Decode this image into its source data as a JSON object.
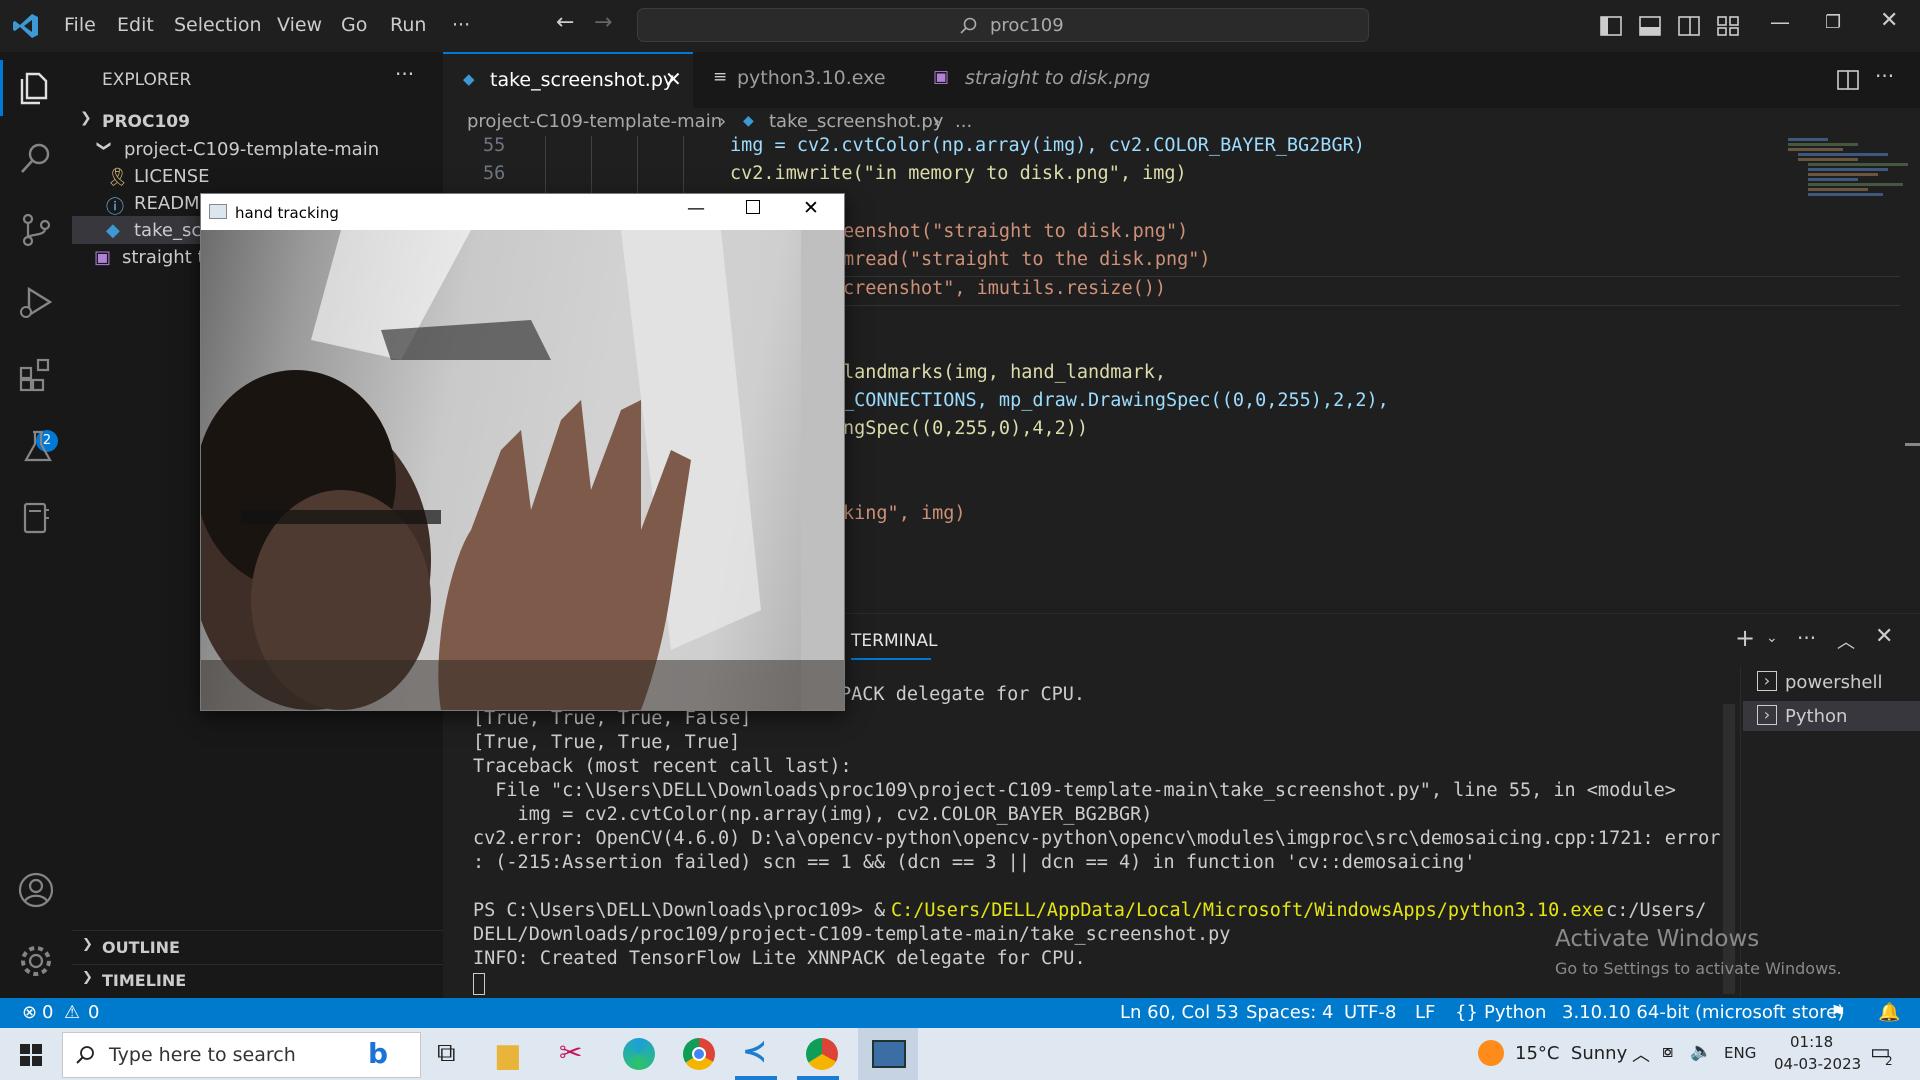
{
  "menu": [
    "File",
    "Edit",
    "Selection",
    "View",
    "Go",
    "Run",
    "···"
  ],
  "command_center": "proc109",
  "activity": {
    "extensions_badge": "2"
  },
  "sidebar": {
    "title": "EXPLORER",
    "root": "PROC109",
    "folder": "project-C109-template-main",
    "files": [
      "LICENSE",
      "READM",
      "take_scr"
    ],
    "root_file": "straight t",
    "outline": "OUTLINE",
    "timeline": "TIMELINE"
  },
  "tabs": [
    {
      "label": "take_screenshot.py"
    },
    {
      "label": "python3.10.exe"
    },
    {
      "label": "straight to disk.png"
    }
  ],
  "breadcrumb": {
    "folder": "project-C109-template-main",
    "file": "take_screenshot.py",
    "more": "..."
  },
  "code": {
    "line55_no": "55",
    "line55": "img = cv2.cvtColor(np.array(img), cv2.COLOR_BAYER_BG2BGR)",
    "line56_no": "56",
    "line56": "cv2.imwrite(\"in memory to disk.png\", img)",
    "l3": "eenshot(\"straight to disk.png\")",
    "l4": "mread(\"straight to the disk.png\")",
    "l5": "creenshot\", imutils.resize())",
    "l6": "landmarks(img, hand_landmark,",
    "l7": "_CONNECTIONS, mp_draw.DrawingSpec((0,0,255),2,2),",
    "l8": "ngSpec((0,255,0),4,2))",
    "l9": "king\", img)"
  },
  "panel": {
    "tab": "TERMINAL",
    "terminals": [
      "powershell",
      "Python"
    ],
    "lines": [
      "PACK delegate for CPU.",
      "[True, True, True, False]",
      "[True, True, True, True]",
      "Traceback (most recent call last):",
      "  File \"c:\\Users\\DELL\\Downloads\\proc109\\project-C109-template-main\\take_screenshot.py\", line 55, in <module>",
      "    img = cv2.cvtColor(np.array(img), cv2.COLOR_BAYER_BG2BGR)",
      "cv2.error: OpenCV(4.6.0) D:\\a\\opencv-python\\opencv-python\\opencv\\modules\\imgproc\\src\\demosaicing.cpp:1721: error",
      ": (-215:Assertion failed) scn == 1 && (dcn == 3 || dcn == 4) in function 'cv::demosaicing'",
      "",
      "PS C:\\Users\\DELL\\Downloads\\proc109> & ",
      "DELL/Downloads/proc109/project-C109-template-main/take_screenshot.py",
      "INFO: Created TensorFlow Lite XNNPACK delegate for CPU."
    ],
    "ps_exe": "C:/Users/DELL/AppData/Local/Microsoft/WindowsApps/python3.10.exe",
    "ps_arg": " c:/Users/"
  },
  "activate": {
    "title": "Activate Windows",
    "sub": "Go to Settings to activate Windows."
  },
  "status": {
    "errors": "0",
    "warnings": "0",
    "position": "Ln 60, Col 53",
    "spaces": "Spaces: 4",
    "encoding": "UTF-8",
    "eol": "LF",
    "language": "Python",
    "interpreter": "3.10.10 64-bit (microsoft store)"
  },
  "cv_window": {
    "title": "hand tracking"
  },
  "taskbar": {
    "search_placeholder": "Type here to search",
    "weather": "15°C  Sunny",
    "lang": "ENG",
    "time": "01:18",
    "date": "04-03-2023",
    "notif_count": "2"
  }
}
